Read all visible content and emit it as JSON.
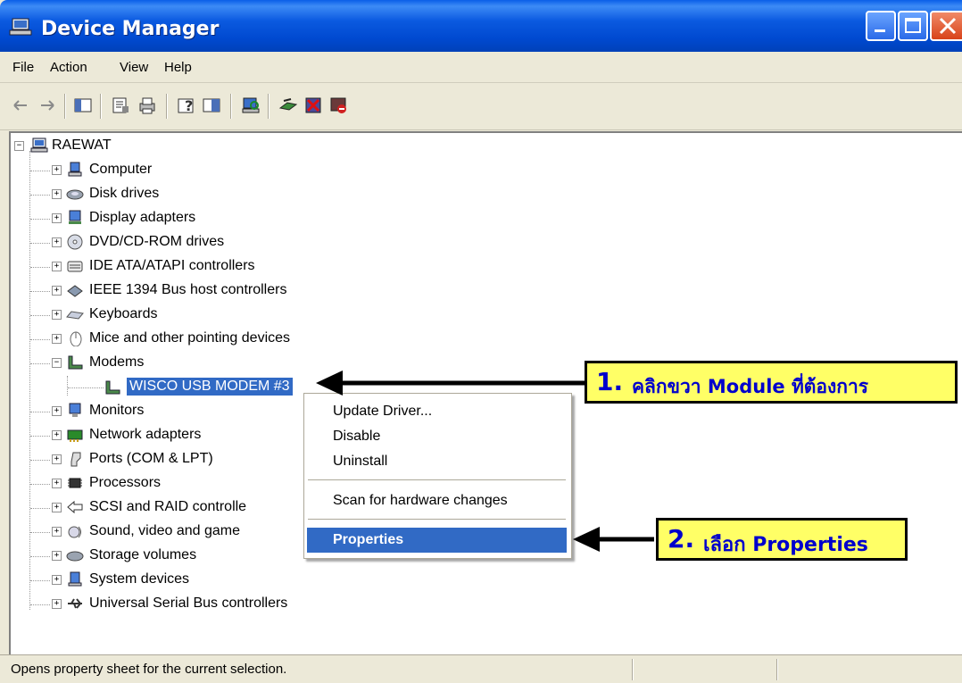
{
  "window": {
    "title": "Device Manager"
  },
  "menu": [
    "File",
    "Action",
    "View",
    "Help"
  ],
  "tree": {
    "root": "RAEWAT",
    "categories": [
      "Computer",
      "Disk drives",
      "Display adapters",
      "DVD/CD-ROM drives",
      "IDE ATA/ATAPI controllers",
      "IEEE 1394 Bus host controllers",
      "Keyboards",
      "Mice and other pointing devices",
      "Modems",
      "Monitors",
      "Network adapters",
      "Ports (COM & LPT)",
      "Processors",
      "SCSI and RAID controlle",
      "Sound, video and game",
      "Storage volumes",
      "System devices",
      "Universal Serial Bus controllers"
    ],
    "expanded_child": "WISCO USB MODEM #3"
  },
  "context_menu": {
    "items": [
      "Update Driver...",
      "Disable",
      "Uninstall",
      "Scan for hardware changes",
      "Properties"
    ],
    "highlighted": "Properties"
  },
  "annotations": {
    "step1_num": "1.",
    "step1_text": "คลิกขวา Module ที่ต้องการ",
    "step2_num": "2.",
    "step2_text": "เลือก Properties"
  },
  "status": {
    "text": "Opens property sheet for the current selection."
  },
  "colors": {
    "selection": "#316ac5",
    "callout_bg": "#ffff66",
    "callout_text": "#0000cc",
    "titlebar": "#0054e3"
  }
}
